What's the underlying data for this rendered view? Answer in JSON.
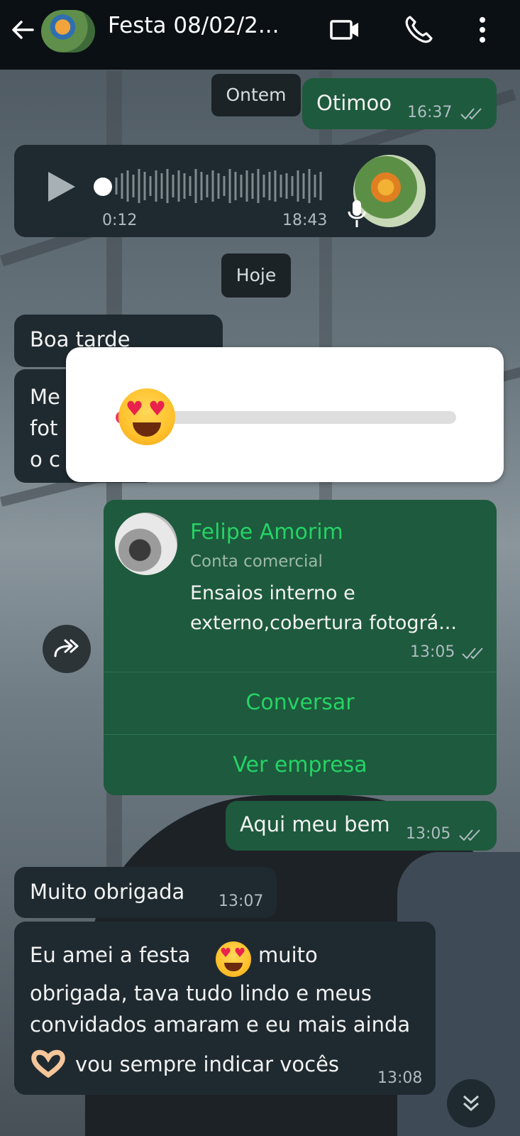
{
  "header": {
    "title": "Festa 08/02/2...",
    "back_icon": "arrow-left-icon",
    "video_icon": "video-camera-icon",
    "call_icon": "phone-icon",
    "menu_icon": "more-vertical-icon"
  },
  "chat": {
    "day_yesterday": "Ontem",
    "day_today": "Hoje",
    "msg_otimoo": {
      "text": "Otimoo",
      "time": "16:37"
    },
    "voice_note": {
      "duration": "0:12",
      "time": "18:43"
    },
    "msg_boa_tarde": {
      "text": "Boa tarde"
    },
    "msg_hidden_lines": [
      "Me",
      "fot",
      "o c"
    ],
    "contact_card": {
      "name": "Felipe Amorim",
      "subtitle": "Conta comercial",
      "description_1": "Ensaios interno e",
      "description_2": "externo,cobertura fotográ...",
      "time": "13:05",
      "action_chat": "Conversar",
      "action_business": "Ver empresa"
    },
    "msg_aqui": {
      "text": "Aqui meu bem",
      "time": "13:05"
    },
    "msg_obrigada": {
      "text": "Muito obrigada",
      "time": "13:07"
    },
    "msg_amei": {
      "line1a": "Eu amei a festa",
      "line1b": "muito",
      "line2": "obrigada, tava tudo lindo e meus",
      "line3": "convidados amaram e eu mais ainda",
      "line4": "vou sempre indicar vocês",
      "time": "13:08"
    }
  },
  "reaction_slider": {
    "emoji": "heart-eyes-emoji",
    "level": 0.03
  },
  "colors": {
    "outgoing_bubble": "#1e5a3d",
    "incoming_bubble": "#1f2a30",
    "accent_green": "#25d366",
    "topbar": "#0b1014"
  }
}
